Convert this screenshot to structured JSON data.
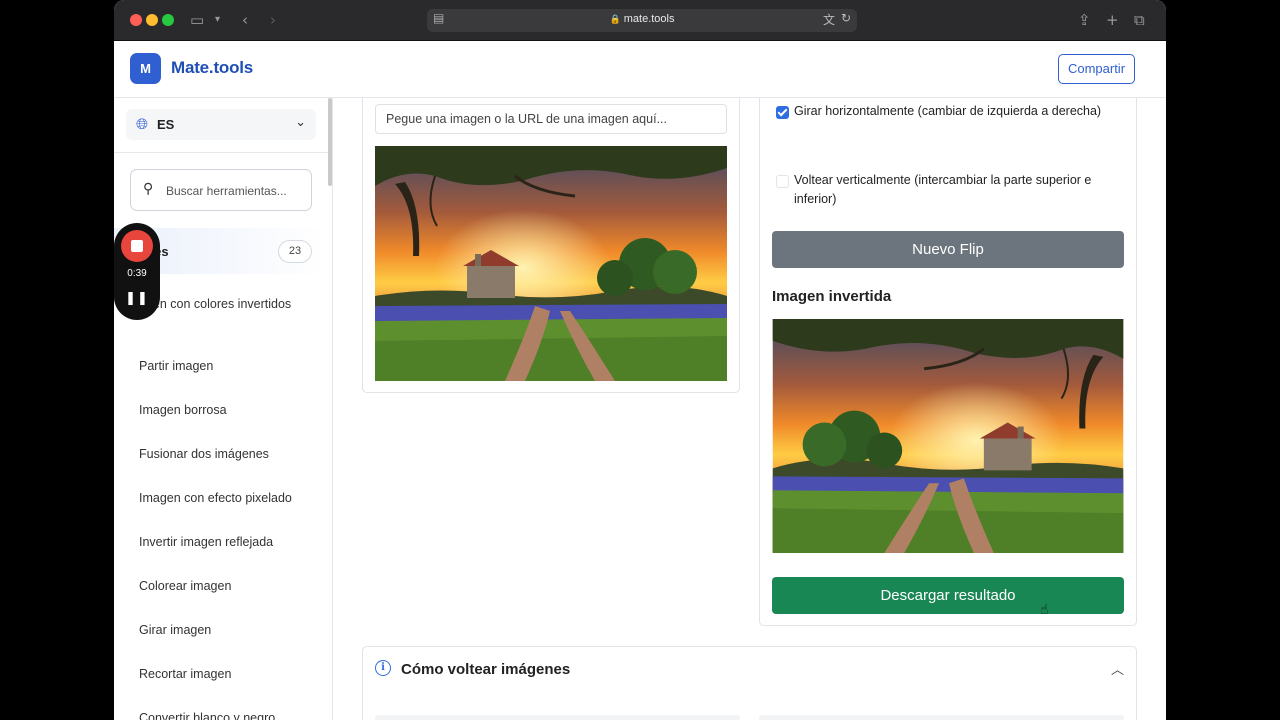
{
  "browser": {
    "url": "mate.tools"
  },
  "header": {
    "logo_letter": "M",
    "brand": "Mate.tools",
    "share_label": "Compartir"
  },
  "sidebar": {
    "language": "ES",
    "search_placeholder": "Buscar herramientas...",
    "category_label": "enes",
    "category_count": "23",
    "items": [
      {
        "label": "agen con colores invertidos"
      },
      {
        "label": "Partir imagen"
      },
      {
        "label": "Imagen borrosa"
      },
      {
        "label": "Fusionar dos imágenes"
      },
      {
        "label": "Imagen con efecto pixelado"
      },
      {
        "label": "Invertir imagen reflejada"
      },
      {
        "label": "Colorear imagen"
      },
      {
        "label": "Girar imagen"
      },
      {
        "label": "Recortar imagen"
      },
      {
        "label": "Convertir blanco y negro"
      }
    ]
  },
  "recorder": {
    "time": "0:39",
    "pause_symbol": "❚❚"
  },
  "main": {
    "url_input_placeholder": "Pegue una imagen o la URL de una imagen aquí...",
    "flip_horizontal_label": "Girar horizontalmente (cambiar de izquierda a derecha)",
    "flip_horizontal_checked": true,
    "flip_vertical_label": "Voltear verticalmente (intercambiar la parte superior e inferior)",
    "flip_vertical_checked": false,
    "new_flip_label": "Nuevo Flip",
    "result_title": "Imagen invertida",
    "download_label": "Descargar resultado",
    "howto_title": "Cómo voltear imágenes"
  },
  "colors": {
    "brand_blue": "#2f5fd0",
    "button_gray": "#6c757d",
    "button_green": "#198754",
    "recorder_red": "#e8453c"
  },
  "icons": [
    "sidebar-toggle-icon",
    "back-icon",
    "forward-icon",
    "lock-icon",
    "translate-icon",
    "reload-icon",
    "share-icon",
    "new-tab-icon",
    "tabs-icon",
    "globe-icon",
    "chevron-down-icon",
    "search-icon",
    "stop-icon",
    "pause-icon",
    "info-icon",
    "chevron-up-icon",
    "cursor-icon"
  ]
}
